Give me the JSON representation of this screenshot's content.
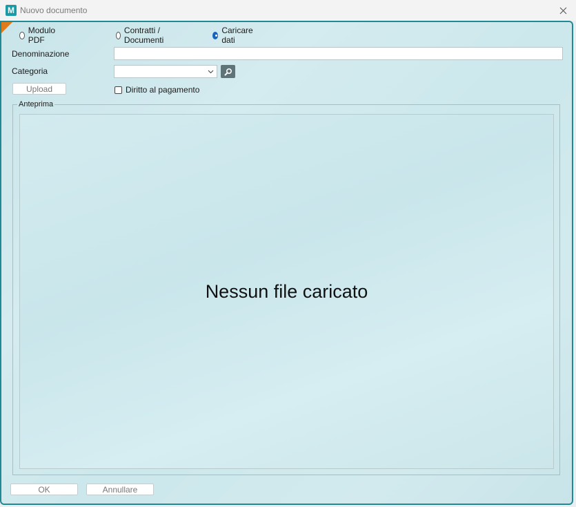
{
  "window": {
    "title": "Nuovo documento",
    "app_icon_letter": "M",
    "close_icon": "close-icon"
  },
  "mode": {
    "options": [
      {
        "label": "Modulo PDF",
        "checked": false
      },
      {
        "label": "Contratti / Documenti",
        "checked": false
      },
      {
        "label": "Caricare dati",
        "checked": true
      }
    ]
  },
  "form": {
    "denominazione_label": "Denominazione",
    "denominazione_value": "",
    "categoria_label": "Categoria",
    "categoria_value": "",
    "search_icon": "search-icon",
    "upload_label": "Upload",
    "diritto_label": "Diritto al pagamento",
    "diritto_checked": false
  },
  "preview": {
    "legend": "Anteprima",
    "empty_message": "Nessun file caricato"
  },
  "footer": {
    "ok_label": "OK",
    "cancel_label": "Annullare"
  },
  "colors": {
    "accent": "#1f8a95",
    "corner": "#e07b1a",
    "radio_selected": "#1565c0"
  }
}
